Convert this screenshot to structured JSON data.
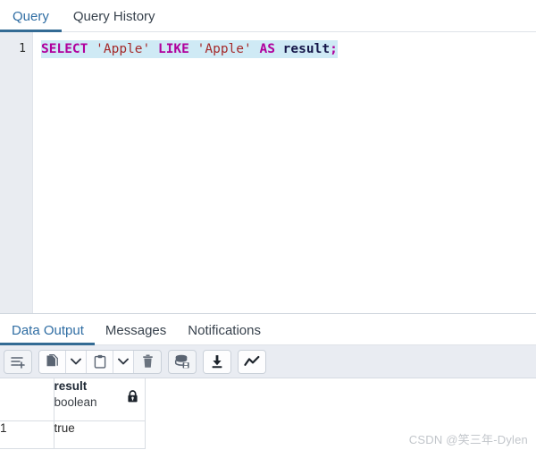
{
  "top_tabs": [
    {
      "label": "Query",
      "active": true,
      "name": "tab-query"
    },
    {
      "label": "Query History",
      "active": false,
      "name": "tab-query-history"
    }
  ],
  "editor": {
    "line_number": "1",
    "sql_text": "SELECT 'Apple' LIKE 'Apple' AS result;",
    "tokens": [
      {
        "text": "SELECT",
        "type": "keyword"
      },
      {
        "text": " ",
        "type": "plain"
      },
      {
        "text": "'Apple'",
        "type": "string"
      },
      {
        "text": " ",
        "type": "plain"
      },
      {
        "text": "LIKE",
        "type": "keyword"
      },
      {
        "text": " ",
        "type": "plain"
      },
      {
        "text": "'Apple'",
        "type": "string"
      },
      {
        "text": " ",
        "type": "plain"
      },
      {
        "text": "AS",
        "type": "keyword"
      },
      {
        "text": " ",
        "type": "plain"
      },
      {
        "text": "result",
        "type": "identifier"
      },
      {
        "text": ";",
        "type": "punctuation"
      }
    ],
    "colors": {
      "keyword": "#b0009c",
      "string": "#a52a2a",
      "identifier": "#16184a",
      "selection_background": "#cfeaf5",
      "gutter_background": "#e9ecf1"
    }
  },
  "bottom_tabs": [
    {
      "label": "Data Output",
      "active": true,
      "name": "tab-data-output"
    },
    {
      "label": "Messages",
      "active": false,
      "name": "tab-messages"
    },
    {
      "label": "Notifications",
      "active": false,
      "name": "tab-notifications"
    }
  ],
  "toolbar": {
    "buttons": [
      {
        "icon": "add-row-icon",
        "name": "add-row-button"
      },
      {
        "icon": "copy-icon",
        "name": "copy-button"
      },
      {
        "icon": "chevron-down-icon",
        "name": "copy-options-button"
      },
      {
        "icon": "paste-icon",
        "name": "paste-button"
      },
      {
        "icon": "chevron-down-icon",
        "name": "paste-options-button"
      },
      {
        "icon": "trash-icon",
        "name": "delete-row-button"
      },
      {
        "icon": "save-data-icon",
        "name": "save-data-changes-button"
      },
      {
        "icon": "download-icon",
        "name": "download-results-button"
      },
      {
        "icon": "graph-visualiser-icon",
        "name": "graph-visualiser-button"
      }
    ]
  },
  "grid": {
    "columns": [
      {
        "name": "",
        "type": "",
        "name_id": "column-rownum"
      },
      {
        "name": "result",
        "type": "boolean",
        "name_id": "column-result",
        "locked": true
      }
    ],
    "rows": [
      {
        "rownum": "1",
        "result": "true"
      }
    ]
  },
  "watermark": {
    "text": "CSDN @笑三年-Dylen"
  },
  "theme": {
    "accent": "#336b94",
    "active_tab_text": "#2f6da3",
    "inactive_tab_text": "#38424d",
    "toolbar_background": "#e9ecf2",
    "grid_border": "#d8dde3"
  }
}
